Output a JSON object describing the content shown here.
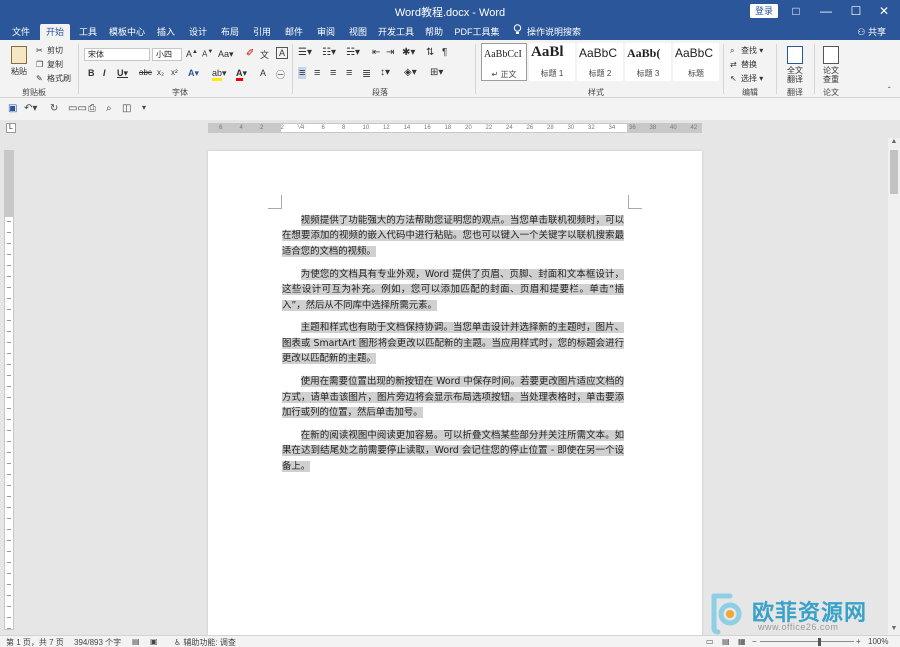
{
  "window": {
    "title": "Word教程.docx  -  Word",
    "login": "登录",
    "controls": [
      "□",
      "—",
      "☐",
      "✕"
    ]
  },
  "menu": {
    "tabs": [
      "文件",
      "开始",
      "工具",
      "模板中心",
      "插入",
      "设计",
      "布局",
      "引用",
      "邮件",
      "审阅",
      "视图",
      "开发工具",
      "帮助",
      "PDF工具集"
    ],
    "active_tab": "开始",
    "tell_me": "操作说明搜索",
    "share": "共享"
  },
  "ribbon": {
    "clipboard": {
      "paste": "粘贴",
      "cut": "剪切",
      "copy": "复制",
      "format_painter": "格式刷",
      "label": "剪贴板"
    },
    "font": {
      "font_name": "宋体",
      "font_size": "小四",
      "label": "字体"
    },
    "paragraph": {
      "label": "段落"
    },
    "styles": {
      "label": "样式",
      "items": [
        {
          "sample": "AaBbCcI",
          "name": "↵ 正文"
        },
        {
          "sample": "AaBl",
          "name": "标题 1"
        },
        {
          "sample": "AaBbC",
          "name": "标题 2"
        },
        {
          "sample": "AaBb(",
          "name": "标题 3"
        },
        {
          "sample": "AaBbC",
          "name": "标题"
        }
      ]
    },
    "editing": {
      "label": "编辑",
      "find": "查找",
      "replace": "替换",
      "select": "选择"
    },
    "translate": {
      "button": "全文翻译",
      "label": "翻译"
    },
    "paper": {
      "button": "论文查重",
      "label": "论文"
    }
  },
  "ruler": {
    "numbers": [
      "6",
      "4",
      "2",
      "2",
      "4",
      "6",
      "8",
      "10",
      "12",
      "14",
      "16",
      "18",
      "20",
      "22",
      "24",
      "26",
      "28",
      "30",
      "32",
      "34",
      "36",
      "38",
      "40",
      "42"
    ]
  },
  "document": {
    "paragraphs": [
      "视频提供了功能强大的方法帮助您证明您的观点。当您单击联机视频时，可以在想要添加的视频的嵌入代码中进行粘贴。您也可以键入一个关键字以联机搜索最适合您的文档的视频。",
      "为使您的文档具有专业外观，Word 提供了页眉、页脚、封面和文本框设计，这些设计可互为补充。例如，您可以添加匹配的封面、页眉和提要栏。单击“插入”，然后从不同库中选择所需元素。",
      "主题和样式也有助于文档保持协调。当您单击设计并选择新的主题时，图片、图表或 SmartArt 图形将会更改以匹配新的主题。当应用样式时，您的标题会进行更改以匹配新的主题。",
      "使用在需要位置出现的新按钮在 Word 中保存时间。若要更改图片适应文档的方式，请单击该图片，图片旁边将会显示布局选项按钮。当处理表格时，单击要添加行或列的位置，然后单击加号。",
      "在新的阅读视图中阅读更加容易。可以折叠文档某些部分并关注所需文本。如果在达到结尾处之前需要停止读取，Word 会记住您的停止位置 - 即使在另一个设备上。"
    ]
  },
  "status": {
    "page": "第 1 页，共 7 页",
    "words": "394/893 个字",
    "accessibility": "辅助功能: 调查",
    "zoom": "100%"
  },
  "watermark": {
    "text": "欧菲资源网",
    "url": "www.office26.com"
  },
  "colors": {
    "accent": "#2b579a",
    "selection": "#d0d0d0",
    "ribbon_bg": "#f3f3f3",
    "workspace": "#e6e6e6"
  }
}
